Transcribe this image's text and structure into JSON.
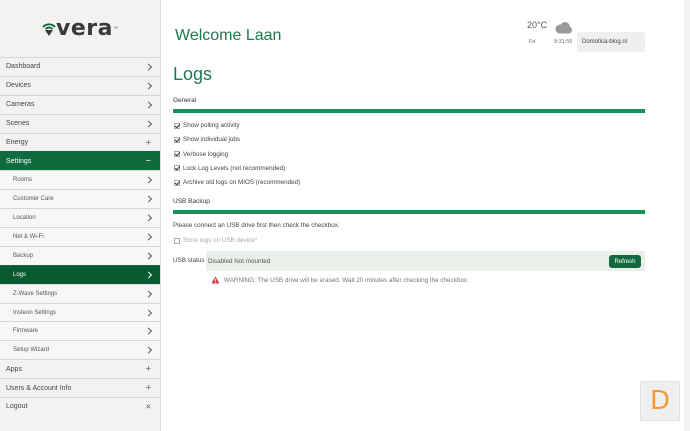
{
  "brand": {
    "logo_text": "vera",
    "trademark": "™",
    "accent": "#0f6b3e",
    "status_green": "#12935a"
  },
  "sidebar": {
    "items": [
      {
        "label": "Dashboard",
        "indicator": "chevron",
        "sub": false,
        "active": false
      },
      {
        "label": "Devices",
        "indicator": "chevron",
        "sub": false,
        "active": false
      },
      {
        "label": "Cameras",
        "indicator": "chevron",
        "sub": false,
        "active": false
      },
      {
        "label": "Scenes",
        "indicator": "chevron",
        "sub": false,
        "active": false
      },
      {
        "label": "Energy",
        "indicator": "+",
        "sub": false,
        "active": false
      },
      {
        "label": "Settings",
        "indicator": "−",
        "sub": false,
        "active": true
      },
      {
        "label": "Rooms",
        "indicator": "chevron",
        "sub": true,
        "active": false
      },
      {
        "label": "Customer Care",
        "indicator": "chevron",
        "sub": true,
        "active": false
      },
      {
        "label": "Location",
        "indicator": "chevron",
        "sub": true,
        "active": false
      },
      {
        "label": "Net & Wi-Fi",
        "indicator": "chevron",
        "sub": true,
        "active": false
      },
      {
        "label": "Backup",
        "indicator": "chevron",
        "sub": true,
        "active": false
      },
      {
        "label": "Logs",
        "indicator": "chevron",
        "sub": true,
        "active": true
      },
      {
        "label": "Z-Wave Settings",
        "indicator": "chevron",
        "sub": true,
        "active": false
      },
      {
        "label": "Insteon Settings",
        "indicator": "chevron",
        "sub": true,
        "active": false
      },
      {
        "label": "Firmware",
        "indicator": "chevron",
        "sub": true,
        "active": false
      },
      {
        "label": "Setup Wizard",
        "indicator": "chevron",
        "sub": true,
        "active": false
      },
      {
        "label": "Apps",
        "indicator": "+",
        "sub": false,
        "active": false
      },
      {
        "label": "Users & Account Info",
        "indicator": "+",
        "sub": false,
        "active": false
      },
      {
        "label": "Logout",
        "indicator": "×",
        "sub": false,
        "active": false
      }
    ]
  },
  "header": {
    "welcome": "Welcome Laan",
    "weather": {
      "temp": "20°C",
      "day": "Fri",
      "time": "9:31:55",
      "icon": "cloud-icon"
    },
    "site": "Domotica-blog.nl"
  },
  "logs": {
    "title": "Logs",
    "general_label": "General",
    "options": [
      {
        "label": "Show polling activity",
        "checked": true
      },
      {
        "label": "Show individual jobs",
        "checked": true
      },
      {
        "label": "Verbose logging",
        "checked": true
      },
      {
        "label": "Lock Log Levels (not recommended)",
        "checked": true
      },
      {
        "label": "Archive old logs on MIOS (recommended)",
        "checked": true
      }
    ],
    "usb_label": "USB Backup",
    "usb_note": "Please connect an USB drive first then check the checkbox.",
    "store_label": "Store logs on USB device*",
    "usb_status_label": "USB status",
    "usb_status_value": "Disabled Not mounted",
    "refresh_label": "Refresh",
    "warning_text": "WARNING: The USB drive will be erased. Wait 20 minutes after checking the checkbox."
  },
  "help_badge": "D"
}
